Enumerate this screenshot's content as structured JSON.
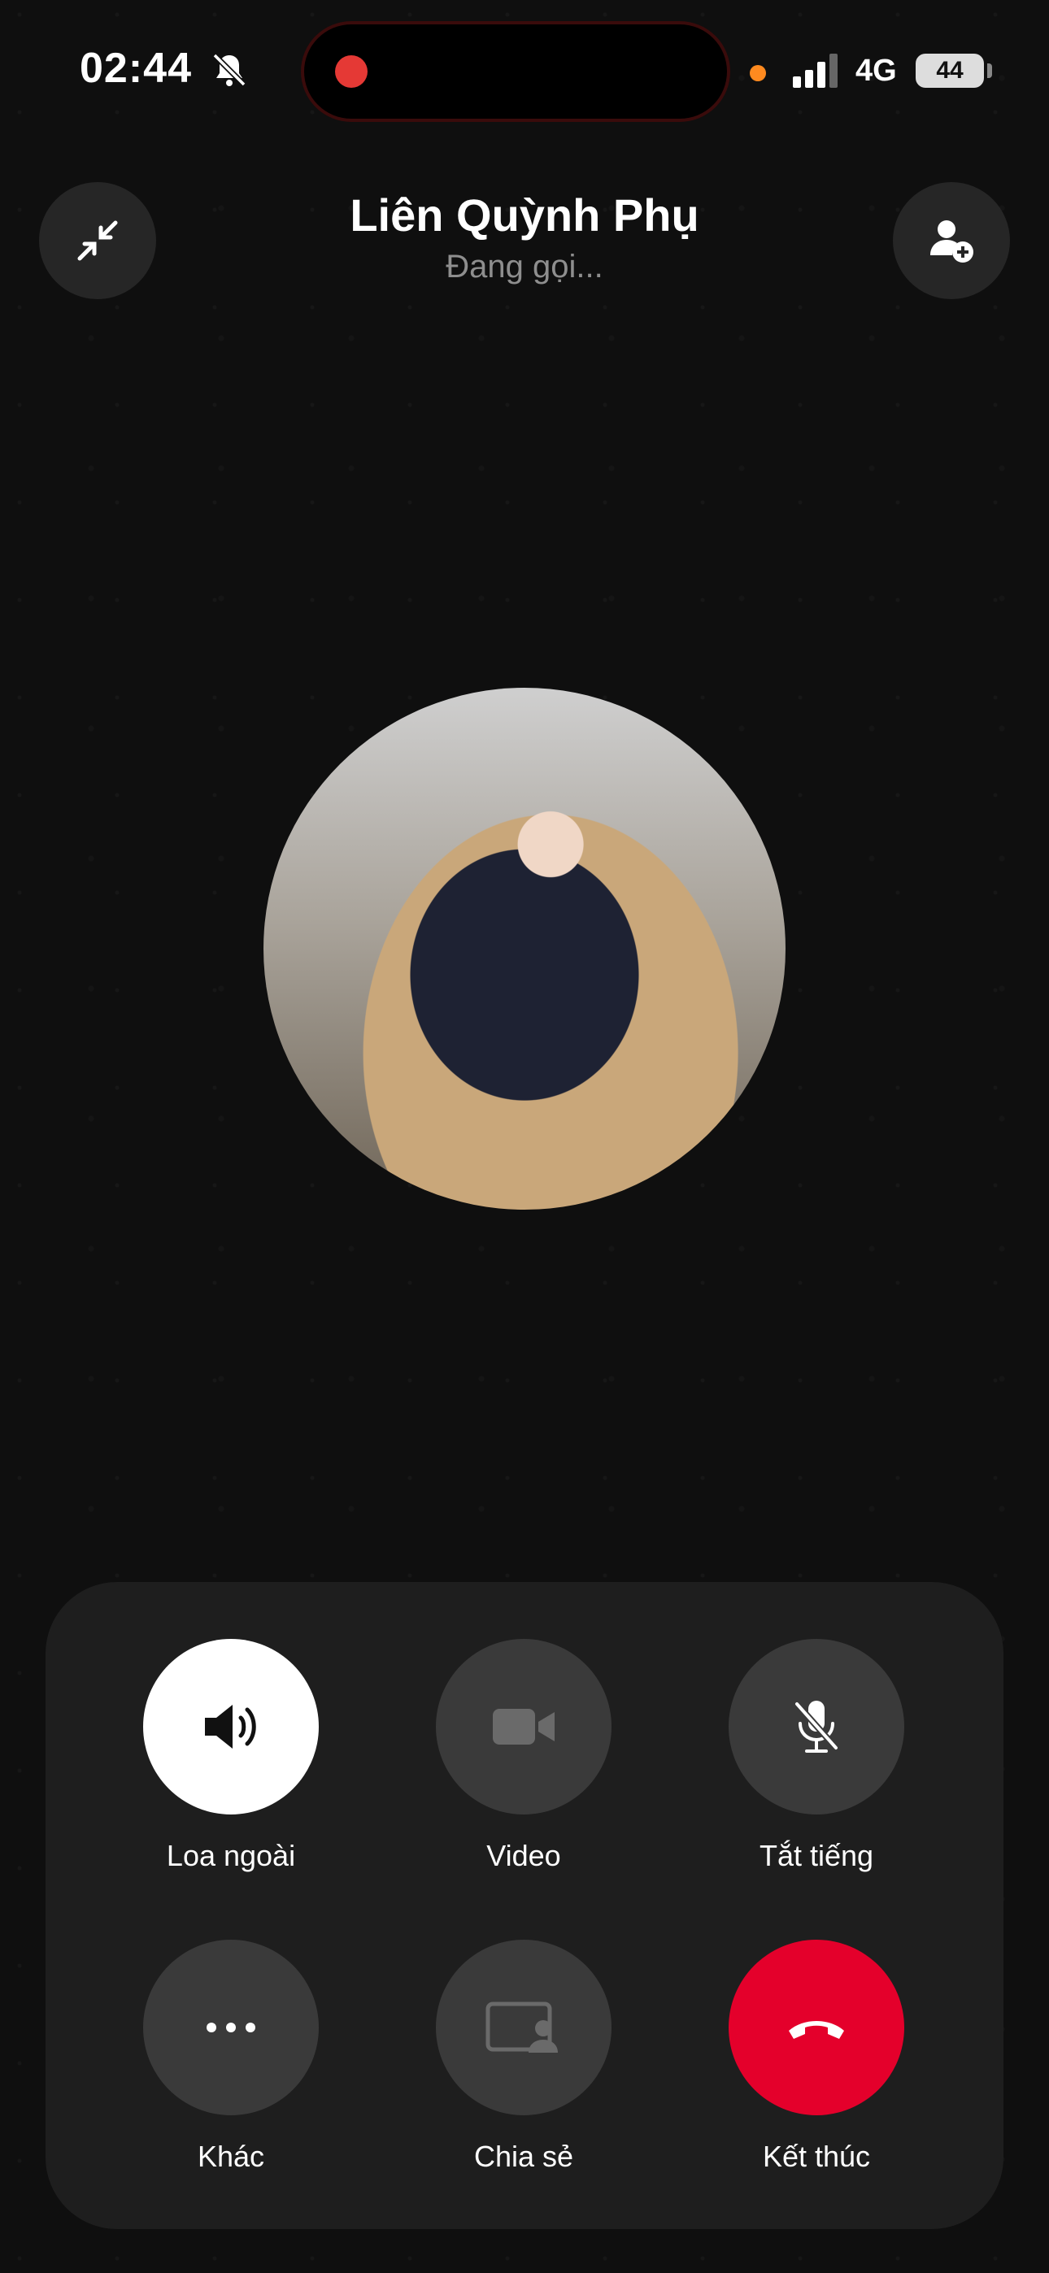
{
  "status_bar": {
    "time": "02:44",
    "network": "4G",
    "battery": "44"
  },
  "call": {
    "contact_name": "Liên Quỳnh Phụ",
    "status": "Đang gọi..."
  },
  "controls": {
    "speaker_label": "Loa ngoài",
    "video_label": "Video",
    "mute_label": "Tắt tiếng",
    "more_label": "Khác",
    "share_label": "Chia sẻ",
    "end_label": "Kết thúc"
  },
  "colors": {
    "end_call": "#e4002b",
    "background": "#0f0f0f",
    "panel": "#1e1e1e"
  },
  "icons": {
    "minimize": "minimize-arrows-icon",
    "add_person": "add-person-icon",
    "speaker": "speaker-icon",
    "video": "video-camera-icon",
    "mute": "microphone-off-icon",
    "more": "more-dots-icon",
    "share": "screen-share-icon",
    "end": "hang-up-icon"
  }
}
